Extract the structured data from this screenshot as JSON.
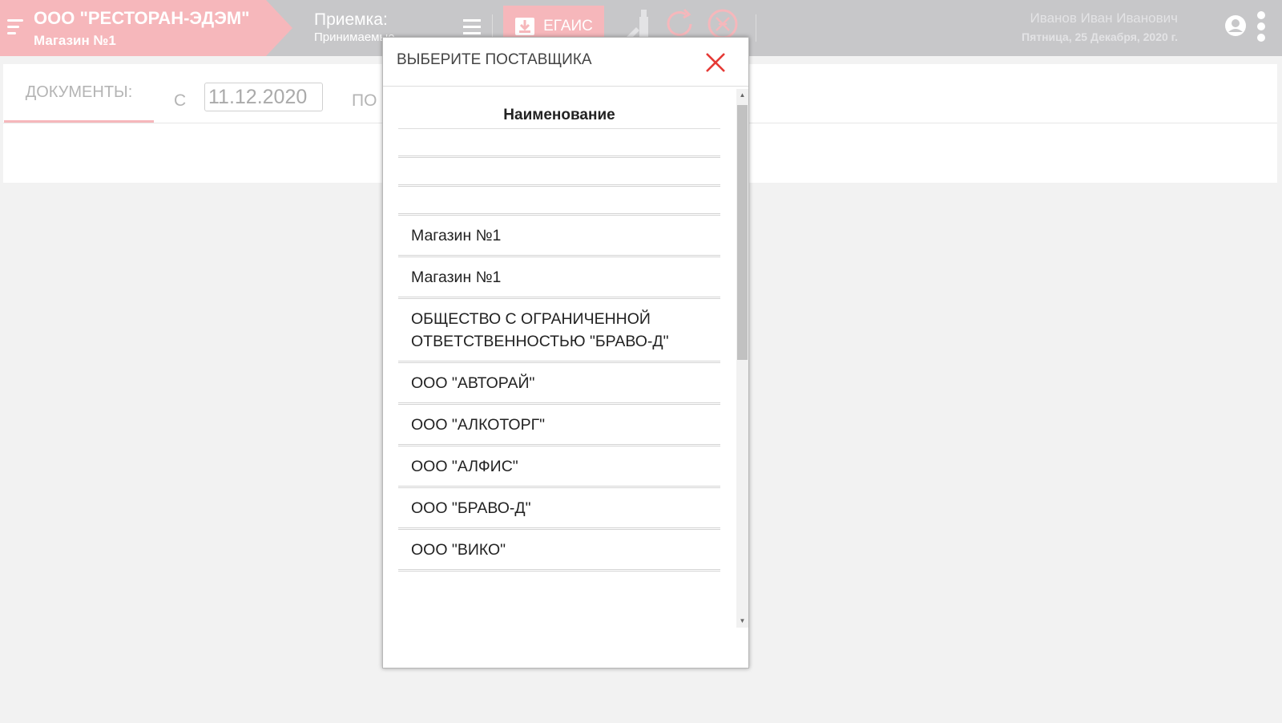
{
  "topbar": {
    "company": "ООО \"РЕСТОРАН-ЭДЭМ\"",
    "store": "Магазин №1",
    "section_title": "Приемка:",
    "section_subtitle": "Принимаемые",
    "egais_label": "ЕГАИС",
    "user_name": "Иванов Иван Иванович",
    "date": "Пятница, 25 Декабря, 2020 г.",
    "icons": [
      "menu-icon",
      "list-menu-icon",
      "download-icon",
      "bottle-icon",
      "refresh-icon",
      "barcode-scan-icon",
      "account-circle-icon",
      "more-vert-icon"
    ]
  },
  "panel": {
    "tab_label": "ДОКУМЕНТЫ:",
    "from_label": "С",
    "date_from": "11.12.2020",
    "to_label": "ПО"
  },
  "modal": {
    "title": "ВЫБЕРИТЕ ПОСТАВЩИКА",
    "column_header": "Наименование",
    "items": [
      "",
      "",
      "",
      "Магазин №1",
      "Магазин №1",
      "ОБЩЕСТВО С ОГРАНИЧЕННОЙ ОТВЕТСТВЕННОСТЬЮ \"БРАВО-Д\"",
      "ООО \"АВТОРАЙ\"",
      "ООО \"АЛКОТОРГ\"",
      "ООО \"АЛФИС\"",
      "ООО \"БРАВО-Д\"",
      "ООО \"ВИКО\""
    ]
  },
  "colors": {
    "accent_pink": "#f6b7bb",
    "topbar_gray": "#c7c7c9",
    "close_red": "#e53935"
  }
}
